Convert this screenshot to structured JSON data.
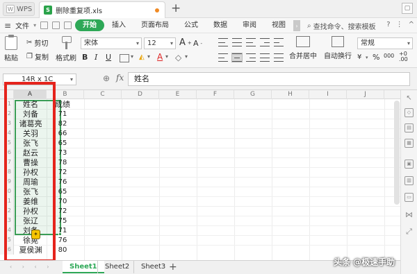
{
  "titlebar": {
    "app_name": "WPS",
    "file_tab": "删除重复项.xls",
    "new_tab": "+"
  },
  "menu": {
    "file_menu": "文件",
    "start_tab": "开始",
    "tabs": [
      "插入",
      "页面布局",
      "公式",
      "数据",
      "审阅",
      "视图"
    ],
    "search_placeholder": "查找命令、搜索模板"
  },
  "ribbon": {
    "paste_label": "粘贴",
    "cut_label": "剪切",
    "copy_label": "复制",
    "format_painter_label": "格式刷",
    "font_name": "宋体",
    "font_size": "12",
    "bold": "B",
    "italic": "I",
    "underline": "U",
    "increase_font": "A",
    "decrease_font": "A",
    "merge_label": "合并居中",
    "wrap_label": "自动换行",
    "number_format": "常规",
    "percent": "%",
    "thousands": "000"
  },
  "formula_bar": {
    "namebox": "14R x 1C",
    "fx": "fx",
    "value": "姓名"
  },
  "grid": {
    "columns": [
      "A",
      "B",
      "C",
      "D",
      "E",
      "F",
      "G",
      "H",
      "I",
      "J"
    ],
    "rows": [
      "1",
      "2",
      "3",
      "4",
      "5",
      "6",
      "7",
      "8",
      "9",
      "10",
      "11",
      "12",
      "13",
      "14",
      "15",
      "16"
    ],
    "col_a": [
      "姓名",
      "刘备",
      "诸葛亮",
      "关羽",
      "张飞",
      "赵云",
      "曹操",
      "孙权",
      "周瑜",
      "张飞",
      "姜维",
      "孙权",
      "张辽",
      "刘备",
      "徐晃",
      "夏侯渊"
    ],
    "col_b": [
      "成绩",
      "71",
      "82",
      "66",
      "65",
      "73",
      "78",
      "72",
      "76",
      "65",
      "70",
      "72",
      "75",
      "71",
      "76",
      "80"
    ]
  },
  "sheets": {
    "tabs": [
      "Sheet1",
      "Sheet2",
      "Sheet3"
    ],
    "add": "+"
  },
  "watermark": "头条 @极速手助",
  "colors": {
    "accent_green": "#2ea857",
    "selection_green": "#3a9d56",
    "annotation_red": "#e5231c"
  }
}
